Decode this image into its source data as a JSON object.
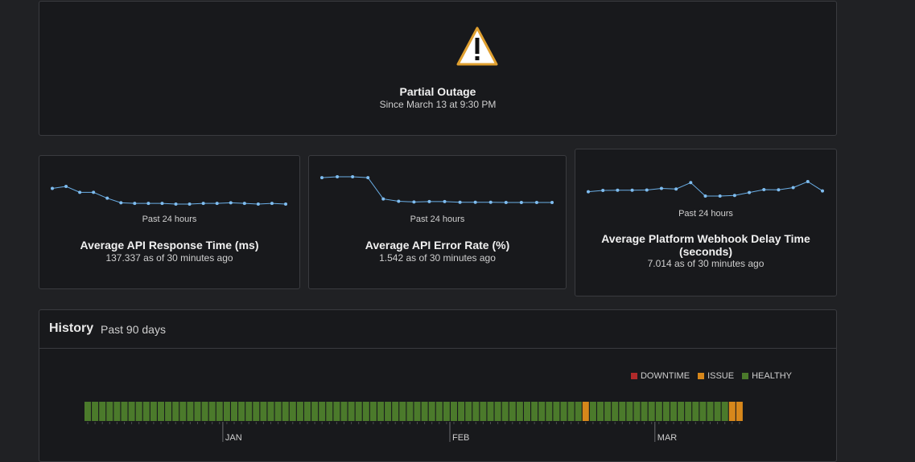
{
  "status": {
    "title": "Partial Outage",
    "since": "Since March 13 at 9:30 PM",
    "icon": "warning-triangle-icon"
  },
  "metrics": [
    {
      "period": "Past 24 hours",
      "title": "Average API Response Time (ms)",
      "value": "137.337 as of 30 minutes ago",
      "series": [
        150,
        153,
        144,
        144,
        135,
        128,
        127,
        127,
        127,
        126,
        126,
        127,
        127,
        128,
        127,
        126,
        127,
        126
      ]
    },
    {
      "period": "Past 24 hours",
      "title": "Average API Error Rate (%)",
      "value": "1.542 as of 30 minutes ago",
      "series": [
        2.95,
        3.0,
        3.0,
        2.95,
        1.75,
        1.62,
        1.58,
        1.6,
        1.6,
        1.56,
        1.56,
        1.56,
        1.55,
        1.55,
        1.55,
        1.55
      ]
    },
    {
      "period": "Past 24 hours",
      "title": "Average Platform Webhook Delay Time (seconds)",
      "value": "7.014 as of 30 minutes ago",
      "series": [
        6.96,
        7.02,
        7.03,
        7.03,
        7.04,
        7.12,
        7.09,
        7.4,
        6.75,
        6.75,
        6.78,
        6.92,
        7.06,
        7.05,
        7.16,
        7.45,
        7.0
      ]
    }
  ],
  "history": {
    "title": "History",
    "subtitle": "Past 90 days",
    "legend": [
      {
        "label": "DOWNTIME",
        "color": "#b02a2a"
      },
      {
        "label": "ISSUE",
        "color": "#d7871b"
      },
      {
        "label": "HEALTHY",
        "color": "#4b7a2b"
      }
    ],
    "days": [
      "healthy",
      "healthy",
      "healthy",
      "healthy",
      "healthy",
      "healthy",
      "healthy",
      "healthy",
      "healthy",
      "healthy",
      "healthy",
      "healthy",
      "healthy",
      "healthy",
      "healthy",
      "healthy",
      "healthy",
      "healthy",
      "healthy",
      "healthy",
      "healthy",
      "healthy",
      "healthy",
      "healthy",
      "healthy",
      "healthy",
      "healthy",
      "healthy",
      "healthy",
      "healthy",
      "healthy",
      "healthy",
      "healthy",
      "healthy",
      "healthy",
      "healthy",
      "healthy",
      "healthy",
      "healthy",
      "healthy",
      "healthy",
      "healthy",
      "healthy",
      "healthy",
      "healthy",
      "healthy",
      "healthy",
      "healthy",
      "healthy",
      "healthy",
      "healthy",
      "healthy",
      "healthy",
      "healthy",
      "healthy",
      "healthy",
      "healthy",
      "healthy",
      "healthy",
      "healthy",
      "healthy",
      "healthy",
      "healthy",
      "healthy",
      "healthy",
      "healthy",
      "healthy",
      "healthy",
      "issue",
      "healthy",
      "healthy",
      "healthy",
      "healthy",
      "healthy",
      "healthy",
      "healthy",
      "healthy",
      "healthy",
      "healthy",
      "healthy",
      "healthy",
      "healthy",
      "healthy",
      "healthy",
      "healthy",
      "healthy",
      "healthy",
      "healthy",
      "issue",
      "issue"
    ],
    "months": [
      {
        "label": "JAN",
        "day_index": 19
      },
      {
        "label": "FEB",
        "day_index": 50
      },
      {
        "label": "MAR",
        "day_index": 78
      }
    ]
  }
}
